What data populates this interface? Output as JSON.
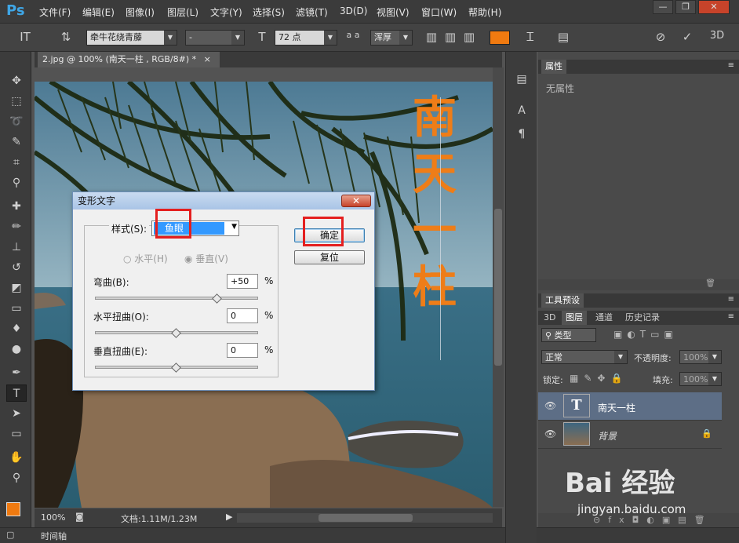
{
  "app": {
    "logo": "Ps"
  },
  "menu": [
    "文件(F)",
    "编辑(E)",
    "图像(I)",
    "图层(L)",
    "文字(Y)",
    "选择(S)",
    "滤镜(T)",
    "3D(D)",
    "视图(V)",
    "窗口(W)",
    "帮助(H)"
  ],
  "window_buttons": {
    "minimize": "—",
    "restore": "❐",
    "close": "✕"
  },
  "options": {
    "font_family": "牵牛花绕青藤",
    "font_style": "-",
    "font_size": "72 点",
    "antialias_prefix": "a a",
    "antialias": "浑厚",
    "color": "#f07a10",
    "threed": "3D"
  },
  "document": {
    "tab_title": "2.jpg @ 100% (南天一柱  , RGB/8#) *",
    "tab_close": "×",
    "canvas_text": [
      "南",
      "天",
      "一",
      "柱"
    ],
    "text_color": "#ee7d18"
  },
  "status": {
    "zoom": "100%",
    "doc_info": "文档:1.11M/1.23M"
  },
  "timeline": {
    "label": "时间轴"
  },
  "properties_panel": {
    "title": "属性",
    "empty_text": "无属性"
  },
  "tool_presets": {
    "title": "工具预设"
  },
  "layers_panel": {
    "tabs": [
      "3D",
      "图层",
      "通道",
      "历史记录"
    ],
    "filter_kind": "类型",
    "blend_mode": "正常",
    "opacity_label": "不透明度:",
    "opacity_value": "100%",
    "lock_label": "锁定:",
    "fill_label": "填充:",
    "fill_value": "100%",
    "layers": [
      {
        "name": "南天一柱",
        "type": "text",
        "thumb": "T"
      },
      {
        "name": "背景",
        "type": "image"
      }
    ]
  },
  "dialog": {
    "title": "变形文字",
    "close": "✕",
    "style_label": "样式(S):",
    "style_value": "鱼眼",
    "horizontal": "水平(H)",
    "vertical": "垂直(V)",
    "bend_label": "弯曲(B):",
    "bend_value": "+50",
    "hdist_label": "水平扭曲(O):",
    "hdist_value": "0",
    "vdist_label": "垂直扭曲(E):",
    "vdist_value": "0",
    "percent": "%",
    "ok": "确定",
    "reset": "复位",
    "bend_level": 0.75,
    "hdist_level": 0.5,
    "vdist_level": 0.5
  },
  "watermark": {
    "brand": "Bai 经验",
    "url": "jingyan.baidu.com"
  }
}
